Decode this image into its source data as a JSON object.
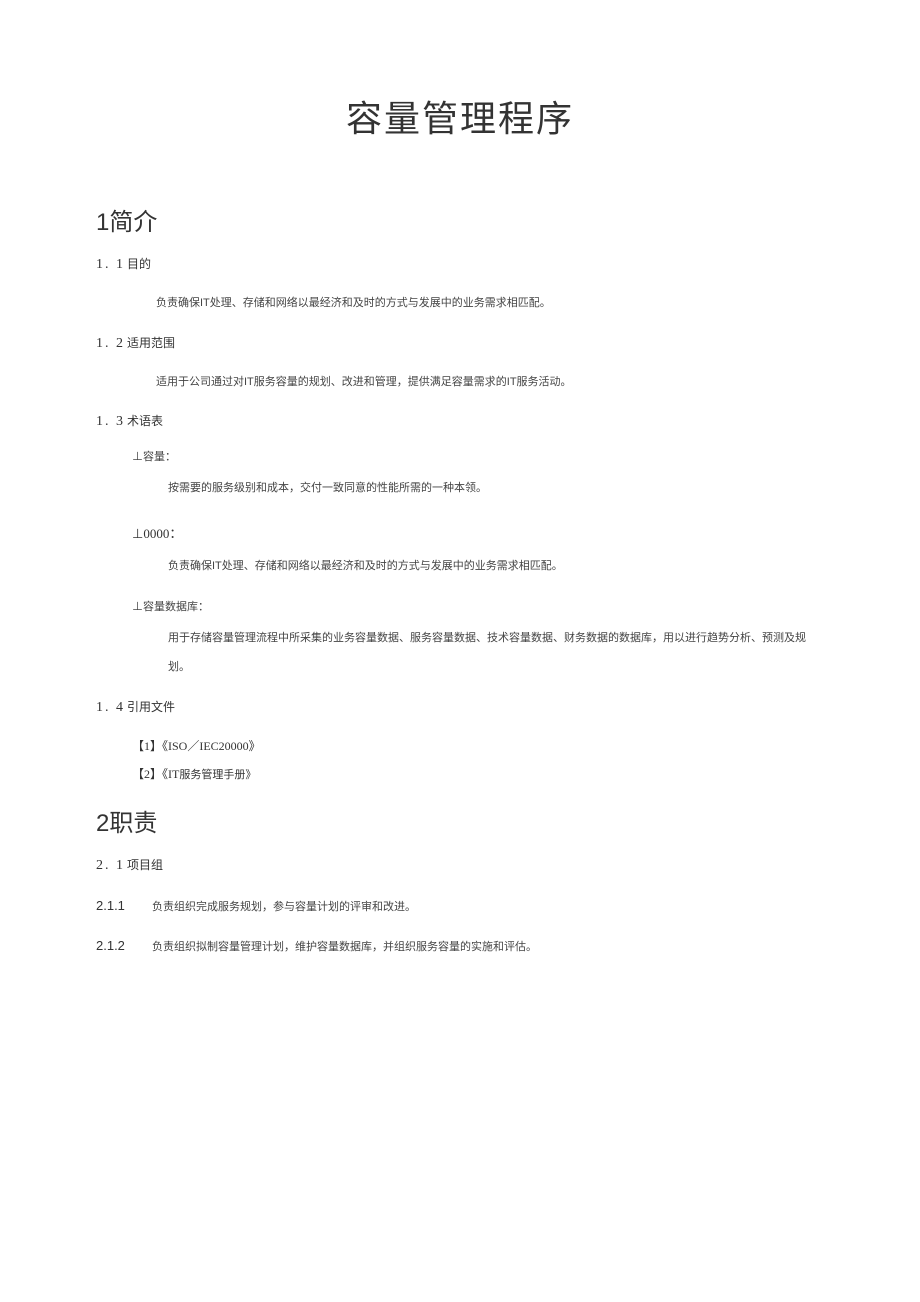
{
  "title": "容量管理程序",
  "s1": {
    "heading": "1简介",
    "s11": {
      "num": "1. 1",
      "label": "目的",
      "text": "负责确保IT处理、存储和网络以最经济和及时的方式与发展中的业务需求相匹配。"
    },
    "s12": {
      "num": "1. 2",
      "label": "适用范围",
      "text": "适用于公司通过对IT服务容量的规划、改进和管理，提供满足容量需求的IT服务活动。"
    },
    "s13": {
      "num": "1. 3",
      "label": "术语表",
      "t1": {
        "label": "⊥容量：",
        "def": "按需要的服务级别和成本，交付一致同意的性能所需的一种本领。"
      },
      "t2": {
        "label": "⊥0000：",
        "def": "负责确保IT处理、存储和网络以最经济和及时的方式与发展中的业务需求相匹配。"
      },
      "t3": {
        "label": "⊥容量数据库：",
        "def": "用于存储容量管理流程中所采集的业务容量数据、服务容量数据、技术容量数据、财务数据的数据库，用以进行趋势分析、预测及规划。"
      }
    },
    "s14": {
      "num": "1. 4",
      "label": "引用文件",
      "r1": "【1】《ISO／IEC20000》",
      "r2_pre": "【2】《IT",
      "r2_post": "服务管理手册》"
    }
  },
  "s2": {
    "heading": "2职责",
    "s21": {
      "num": "2. 1",
      "label": "项目组"
    },
    "i211": {
      "num": "2.1.1",
      "text": "负责组织完成服务规划，参与容量计划的评审和改进。"
    },
    "i212": {
      "num": "2.1.2",
      "text": "负责组织拟制容量管理计划，维护容量数据库，并组织服务容量的实施和评估。"
    }
  }
}
